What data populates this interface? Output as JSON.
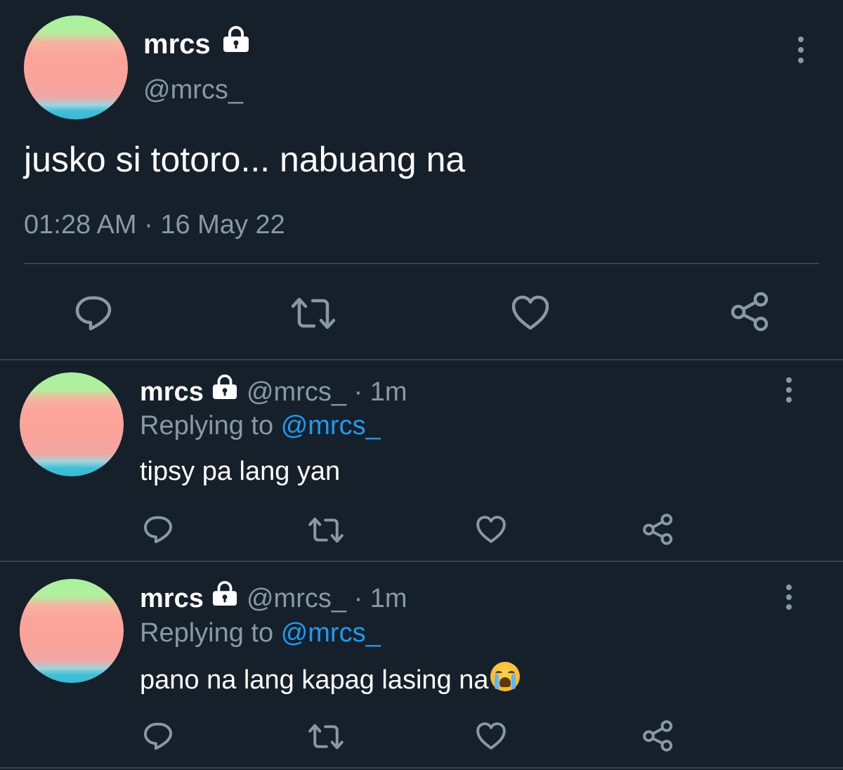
{
  "main_tweet": {
    "display_name": "mrcs",
    "handle": "@mrcs_",
    "text": "jusko si totoro... nabuang na",
    "time": "01:28 AM",
    "separator": "·",
    "date": "16 May 22",
    "icons": [
      "lock-icon",
      "more-icon",
      "reply-icon",
      "retweet-icon",
      "like-icon",
      "share-icon"
    ]
  },
  "replies": [
    {
      "display_name": "mrcs",
      "handle": "@mrcs_",
      "separator": "·",
      "age": "1m",
      "replying_label": "Replying to",
      "replying_handle": "@mrcs_",
      "text": "tipsy pa lang yan"
    },
    {
      "display_name": "mrcs",
      "handle": "@mrcs_",
      "separator": "·",
      "age": "1m",
      "replying_label": "Replying to",
      "replying_handle": "@mrcs_",
      "text": "pano na lang kapag lasing na",
      "emoji": "loudly-crying-face-emoji"
    }
  ],
  "colors": {
    "background": "#15202b",
    "text": "#ffffff",
    "secondary_text": "#8899a6",
    "link": "#1d9bf0",
    "divider": "#38444d"
  }
}
